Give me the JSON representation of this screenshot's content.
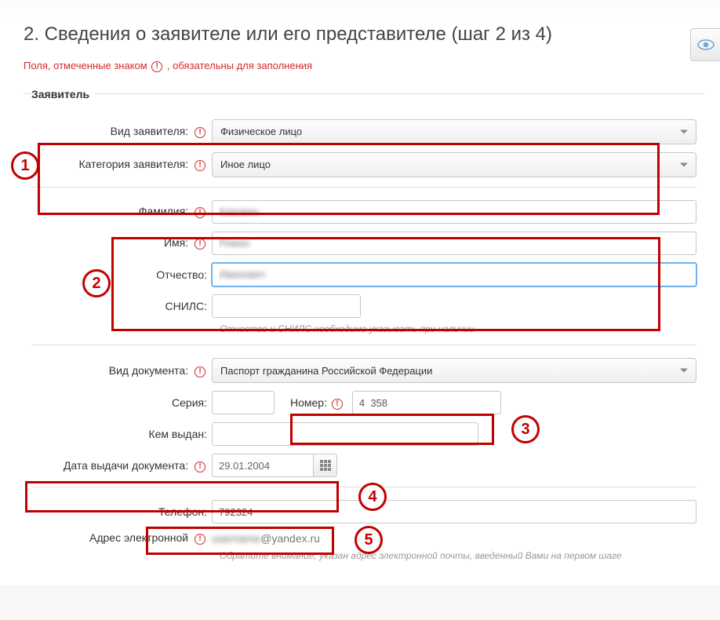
{
  "title": "2. Сведения о заявителе или его представителе (шаг 2 из 4)",
  "required_note_pre": "Поля, отмеченные знаком ",
  "required_note_post": ", обязательны для заполнения",
  "legend": "Заявитель",
  "labels": {
    "applicant_type": "Вид заявителя:",
    "applicant_category": "Категория заявителя:",
    "surname": "Фамилия:",
    "name": "Имя:",
    "patronymic": "Отчество:",
    "snils": "СНИЛС:",
    "doc_type": "Вид документа:",
    "series": "Серия:",
    "number": "Номер:",
    "issued_by": "Кем выдан:",
    "issue_date": "Дата выдачи документа:",
    "phone": "Телефон:",
    "email": "Адрес электронной"
  },
  "values": {
    "applicant_type": "Физическое лицо",
    "applicant_category": "Иное лицо",
    "surname": "Коровин",
    "name": "Роман",
    "patronymic": "Иванович",
    "snils": "",
    "doc_type": "Паспорт гражданина Российской Федерации",
    "series": "",
    "number": "4  358",
    "issued_by": "",
    "issue_date": "29.01.2004",
    "phone": "792324    ",
    "email_masked": "@yandex.ru"
  },
  "hints": {
    "snils": "Отчество и СНИЛС необходимо указывать при наличии",
    "email": "Обратите внимание, указан адрес электронной почты, введенный Вами на первом шаге"
  },
  "annotations": {
    "n1": "1",
    "n2": "2",
    "n3": "3",
    "n4": "4",
    "n5": "5"
  }
}
